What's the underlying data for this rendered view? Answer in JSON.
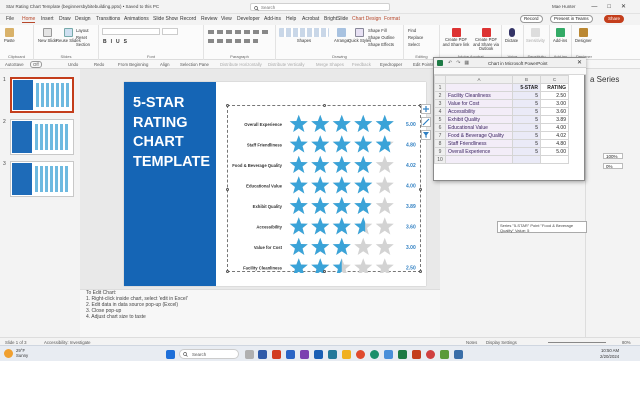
{
  "window": {
    "title": "Star Rating Chart Template (beginnersbybitebuilding.pptx) • Saved to this PC",
    "search_placeholder": "Search",
    "user": "Mae Hunter",
    "controls": [
      "—",
      "□",
      "✕"
    ]
  },
  "tabs": [
    "File",
    "Home",
    "Insert",
    "Draw",
    "Design",
    "Transitions",
    "Animations",
    "Slide Show",
    "Record",
    "Review",
    "View",
    "Developer",
    "Add-ins",
    "Help",
    "Acrobat",
    "BrightSlide",
    "Chart Design",
    "Format"
  ],
  "active_tab": "Home",
  "tab_actions": {
    "record": "Record",
    "present": "Present in Teams",
    "share": "Share"
  },
  "ribbon": {
    "groups": [
      "Clipboard",
      "Slides",
      "Font",
      "Paragraph",
      "Drawing",
      "Editing",
      "Adobe Acrobat",
      "Voice",
      "Sensitivity",
      "Add-ins",
      "Designer"
    ],
    "buttons": {
      "paste": "Paste",
      "new_slide": "New Slide",
      "reuse_slides": "Reuse Slides",
      "layout": "Layout",
      "reset": "Reset",
      "section": "Section",
      "shapes": "Shapes",
      "arrange": "Arrange",
      "quick_styles": "Quick Styles",
      "shape_fill": "Shape Fill",
      "shape_outline": "Shape Outline",
      "shape_effects": "Shape Effects",
      "find": "Find",
      "replace": "Replace",
      "select": "Select",
      "create_pdf": "Create PDF and Share link",
      "create_pdf_outlook": "Create PDF and Share via Outlook",
      "dictate": "Dictate",
      "sensitivity": "Sensitivity",
      "addins": "Add-ins",
      "designer": "Designer"
    }
  },
  "format_row": [
    "AutoSave",
    "Off",
    "Undo",
    "Redo",
    "From Beginning",
    "Align",
    "Selection Pane",
    "Distribute Horizontally",
    "Distribute Vertically",
    "Merge Shapes",
    "Feedback",
    "Eyedropper",
    "Edit Points",
    "Add-ins",
    "Action"
  ],
  "thumbnails": [
    {
      "num": "1"
    },
    {
      "num": "2"
    },
    {
      "num": "3"
    }
  ],
  "slide": {
    "title_lines": [
      "5-STAR",
      "RATING",
      "CHART",
      "TEMPLATE"
    ],
    "chart": {}
  },
  "chart_data": {
    "type": "bar",
    "categories": [
      "Overall Experience",
      "Staff Friendliness",
      "Food & Beverage Quality",
      "Educational Value",
      "Exhibit Quality",
      "Accessibility",
      "Value for Cost",
      "Facility Cleanliness"
    ],
    "values": [
      5.0,
      4.8,
      4.02,
      4.0,
      3.89,
      3.6,
      3.0,
      2.5
    ],
    "value_labels": [
      "5.00",
      "4.80",
      "4.02",
      "4.00",
      "3.89",
      "3.60",
      "3.00",
      "2.50"
    ],
    "max_stars": 5,
    "xlim": [
      0,
      5
    ],
    "colors": {
      "filled": "#3aa3d8",
      "empty": "#d3d3d3",
      "label": "#2f7fc2"
    }
  },
  "notes": [
    "To Edit Chart:",
    "1.   Right-click inside chart, select 'edit in Excel'",
    "2.   Edit data in data source pop-up (Excel)",
    "3.   Close pop-up",
    "4.   Adjust chart size to taste"
  ],
  "excel": {
    "title": "Chart in Microsoft PowerPoint",
    "columns": [
      "",
      "A",
      "B",
      "C"
    ],
    "headers": [
      "",
      "5-STAR",
      "RATING"
    ],
    "rows": [
      [
        "Facility Cleanliness",
        "5",
        "2.50"
      ],
      [
        "Value for Cost",
        "5",
        "3.00"
      ],
      [
        "Accessibility",
        "5",
        "3.60"
      ],
      [
        "Exhibit Quality",
        "5",
        "3.89"
      ],
      [
        "Educational Value",
        "5",
        "4.00"
      ],
      [
        "Food & Beverage Quality",
        "5",
        "4.02"
      ],
      [
        "Staff Friendliness",
        "5",
        "4.80"
      ],
      [
        "Overall Experience",
        "5",
        "5.00"
      ],
      [
        "",
        "",
        ""
      ]
    ]
  },
  "tooltip": "Series \"5-STAR\" Point \"Food & Beverage Quality\" Value: 5",
  "right_pane": {
    "title": "a Series",
    "field_1": "100%",
    "field_2": "0%"
  },
  "status": {
    "slide": "Slide 1 of 3",
    "accessibility": "Accessibility: Investigate",
    "notes": "Notes",
    "display": "Display Settings",
    "zoom": "80%"
  },
  "taskbar": {
    "weather_temp": "29°F",
    "weather_desc": "Sunny",
    "search": "Search",
    "time": "10:50 AM",
    "date": "2/20/2024"
  }
}
